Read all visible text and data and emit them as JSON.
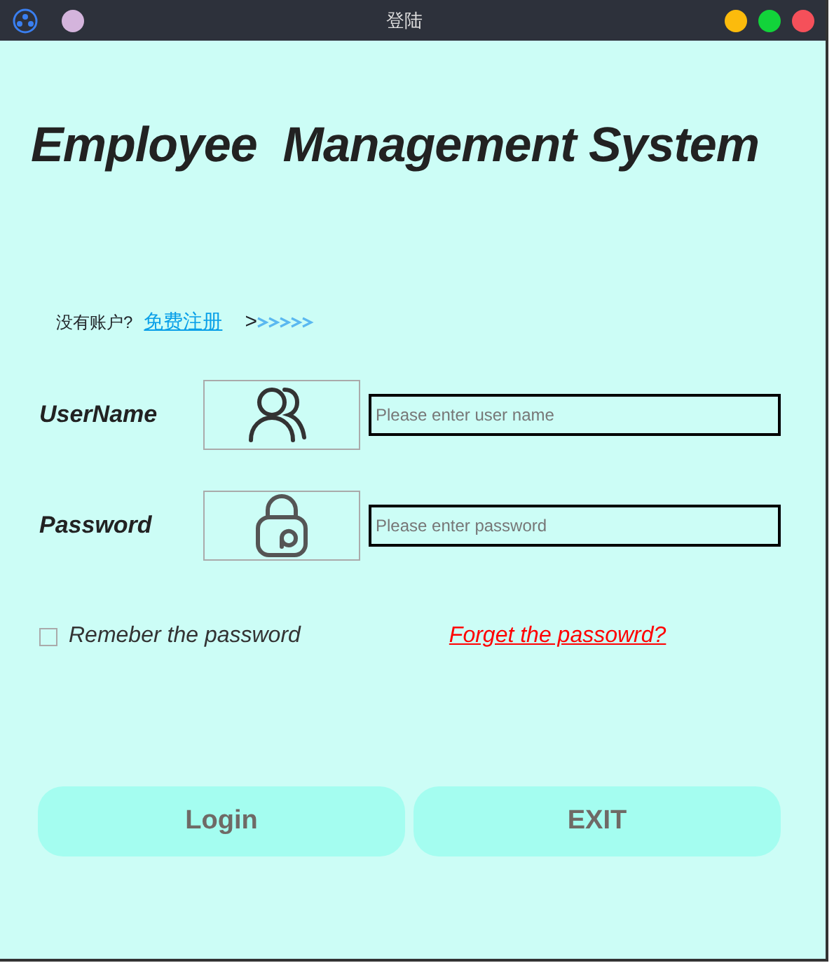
{
  "window": {
    "title": "登陆"
  },
  "heading": "Employee  Management System",
  "register": {
    "prompt": "没有账户?",
    "link": "免费注册",
    "arrow": ">"
  },
  "fields": [
    {
      "kind": "user",
      "label": "UserName",
      "placeholder": "Please enter user name"
    },
    {
      "kind": "lock",
      "label": "Password",
      "placeholder": "Please enter password"
    }
  ],
  "remember": {
    "label": "Remeber the password",
    "checked": false
  },
  "forgot": "Forget the passowrd?",
  "buttons": [
    "Login",
    "EXIT"
  ]
}
